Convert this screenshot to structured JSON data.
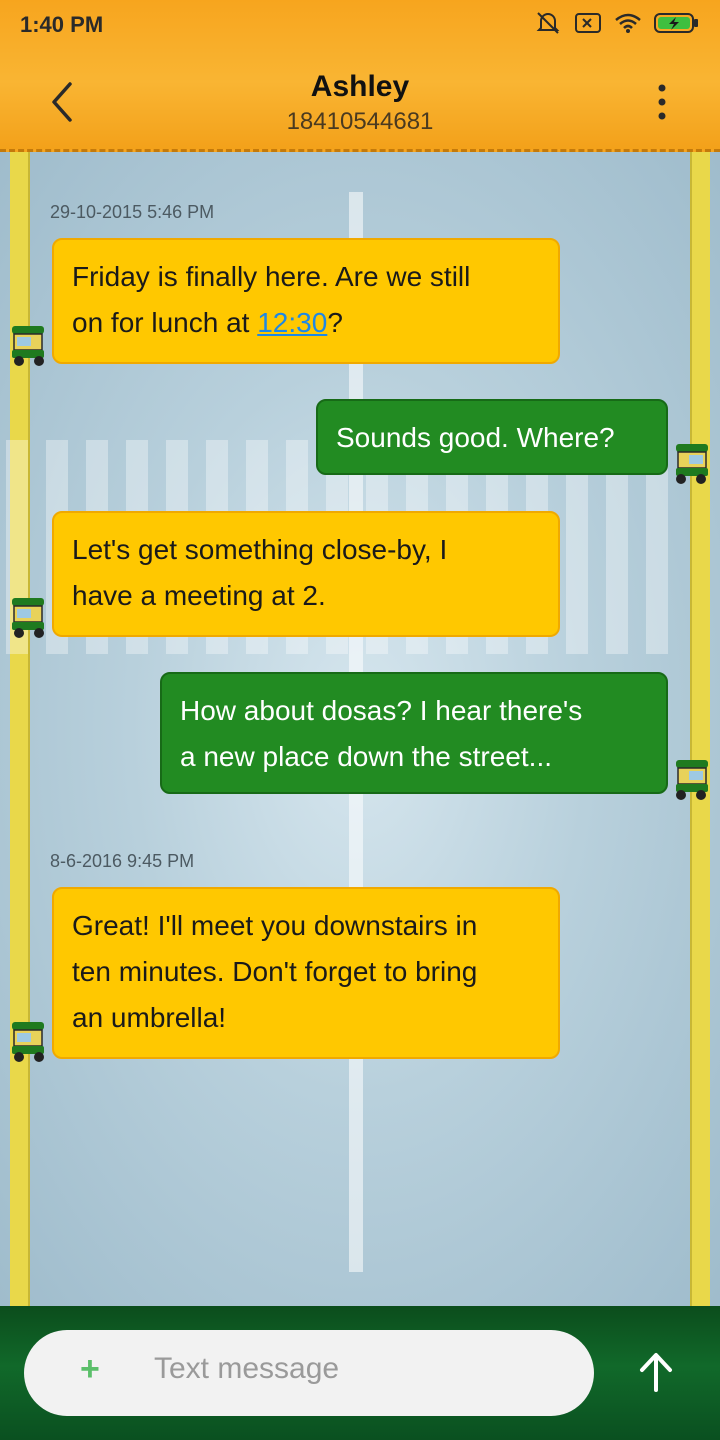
{
  "status_bar": {
    "time": "1:40 PM"
  },
  "header": {
    "contact_name": "Ashley",
    "contact_number": "18410544681"
  },
  "messages": [
    {
      "timestamp": "29-10-2015 5:46 PM"
    },
    {
      "direction": "incoming",
      "line1": "Friday is finally here. Are we still",
      "line2_prefix": "on for lunch at ",
      "link": "12:30",
      "line2_suffix": "?"
    },
    {
      "direction": "outgoing",
      "text": "Sounds good. Where?"
    },
    {
      "direction": "incoming",
      "line1": "Let's get something close-by, I",
      "line2": "have a meeting at 2."
    },
    {
      "direction": "outgoing",
      "line1": "How about dosas? I hear there's",
      "line2": "a new place down the street..."
    },
    {
      "timestamp": "8-6-2016 9:45 PM"
    },
    {
      "direction": "incoming",
      "line1": "Great! I'll meet you downstairs in",
      "line2": "ten minutes. Don't forget to bring",
      "line3": "an umbrella!"
    }
  ],
  "composer": {
    "plus_label": "+",
    "placeholder": "Text message"
  },
  "icons": {
    "back": "chevron-left-icon",
    "more": "more-vertical-icon",
    "send": "arrow-up-icon",
    "avatar": "auto-rickshaw-icon"
  },
  "colors": {
    "header": "#f9b533",
    "incoming_bubble": "#ffc800",
    "outgoing_bubble": "#228b22",
    "link": "#1e88e5",
    "bottom_bar": "#11692a"
  }
}
